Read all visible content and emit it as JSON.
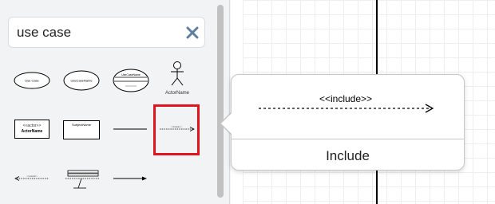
{
  "search": {
    "value": "use case",
    "clear_icon": "close-icon"
  },
  "shapes": [
    {
      "name": "use-case-ellipse",
      "label": "Use Case"
    },
    {
      "name": "use-case-extension-points",
      "label": "UseCaseName"
    },
    {
      "name": "use-case-with-compartments",
      "label": "UseCaseName"
    },
    {
      "name": "actor",
      "label": "ActorName"
    },
    {
      "name": "actor-box",
      "stereotype": "<<actor>>",
      "label": "ActorName"
    },
    {
      "name": "subject-box",
      "label": "SubjectName"
    },
    {
      "name": "association-line",
      "label": ""
    },
    {
      "name": "include-arrow",
      "label": ""
    },
    {
      "name": "extend-arrow",
      "label": ""
    },
    {
      "name": "extension-note",
      "label": ""
    },
    {
      "name": "directed-association",
      "label": ""
    }
  ],
  "tooltip": {
    "preview_label": "<<include>>",
    "title": "Include"
  },
  "colors": {
    "selection": "#e0141e",
    "sidebar_bg": "#f1f3f4",
    "grid": "#eeeeee"
  }
}
